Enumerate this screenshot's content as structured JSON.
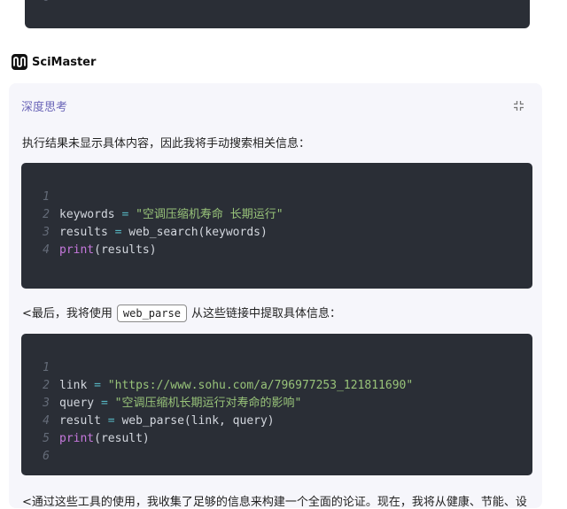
{
  "top_code": {
    "line_number": "6"
  },
  "brand": {
    "name": "SciMaster"
  },
  "thinking": {
    "title": "深度思考"
  },
  "paragraph1": "执行结果未显示具体内容，因此我将手动搜索相关信息：",
  "code1": {
    "lines": [
      {
        "n": "1",
        "tokens": []
      },
      {
        "n": "2",
        "tokens": [
          {
            "t": "keywords ",
            "c": "plain"
          },
          {
            "t": "=",
            "c": "op"
          },
          {
            "t": " ",
            "c": "plain"
          },
          {
            "t": "\"空调压缩机寿命 长期运行\"",
            "c": "str"
          }
        ]
      },
      {
        "n": "3",
        "tokens": [
          {
            "t": "results ",
            "c": "plain"
          },
          {
            "t": "=",
            "c": "op"
          },
          {
            "t": " web_search(keywords)",
            "c": "plain"
          }
        ]
      },
      {
        "n": "4",
        "tokens": [
          {
            "t": "print",
            "c": "kw"
          },
          {
            "t": "(results)",
            "c": "plain"
          }
        ]
      }
    ]
  },
  "paragraph2": {
    "before": "<最后，我将使用",
    "code": "web_parse",
    "after": "从这些链接中提取具体信息："
  },
  "code2": {
    "lines": [
      {
        "n": "1",
        "tokens": []
      },
      {
        "n": "2",
        "tokens": [
          {
            "t": "link ",
            "c": "plain"
          },
          {
            "t": "=",
            "c": "op"
          },
          {
            "t": " ",
            "c": "plain"
          },
          {
            "t": "\"https://www.sohu.com/a/796977253_121811690\"",
            "c": "str"
          }
        ]
      },
      {
        "n": "3",
        "tokens": [
          {
            "t": "query ",
            "c": "plain"
          },
          {
            "t": "=",
            "c": "op"
          },
          {
            "t": " ",
            "c": "plain"
          },
          {
            "t": "\"空调压缩机长期运行对寿命的影响\"",
            "c": "str"
          }
        ]
      },
      {
        "n": "4",
        "tokens": [
          {
            "t": "result ",
            "c": "plain"
          },
          {
            "t": "=",
            "c": "op"
          },
          {
            "t": " web_parse(link, query)",
            "c": "plain"
          }
        ]
      },
      {
        "n": "5",
        "tokens": [
          {
            "t": "print",
            "c": "kw"
          },
          {
            "t": "(result)",
            "c": "plain"
          }
        ]
      },
      {
        "n": "6",
        "tokens": []
      }
    ]
  },
  "paragraph3": "<通过这些工具的使用，我收集了足够的信息来构建一个全面的论证。现在，我将从健康、节能、设"
}
